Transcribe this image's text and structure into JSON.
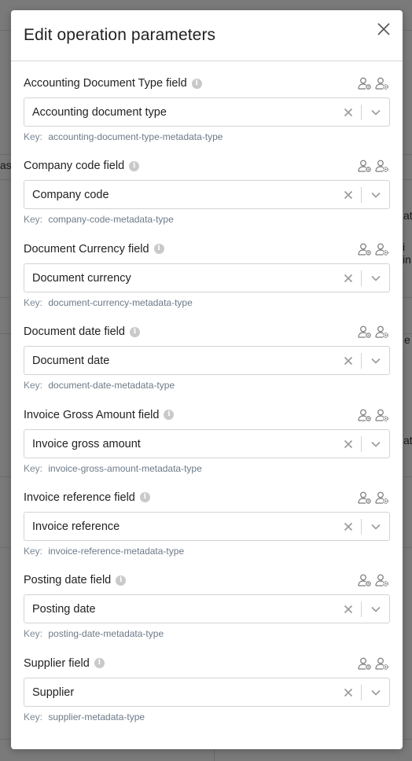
{
  "background": {
    "fragments": [
      "as",
      "ati",
      "i in",
      "at",
      "e"
    ]
  },
  "modal": {
    "title": "Edit operation parameters",
    "close_icon": "close-icon",
    "key_label": "Key:",
    "fields": [
      {
        "label": "Accounting Document Type field",
        "value": "Accounting document type",
        "key": "accounting-document-type-metadata-type"
      },
      {
        "label": "Company code field",
        "value": "Company code",
        "key": "company-code-metadata-type"
      },
      {
        "label": "Document Currency field",
        "value": "Document currency",
        "key": "document-currency-metadata-type"
      },
      {
        "label": "Document date field",
        "value": "Document date",
        "key": "document-date-metadata-type"
      },
      {
        "label": "Invoice Gross Amount field",
        "value": "Invoice gross amount",
        "key": "invoice-gross-amount-metadata-type"
      },
      {
        "label": "Invoice reference field",
        "value": "Invoice reference",
        "key": "invoice-reference-metadata-type"
      },
      {
        "label": "Posting date field",
        "value": "Posting date",
        "key": "posting-date-metadata-type"
      },
      {
        "label": "Supplier field",
        "value": "Supplier",
        "key": "supplier-metadata-type"
      }
    ]
  },
  "colors": {
    "overlay": "#7d7d7d",
    "modal_bg": "#ffffff",
    "key_text": "#6c7a88",
    "border": "#d3d3d3"
  }
}
